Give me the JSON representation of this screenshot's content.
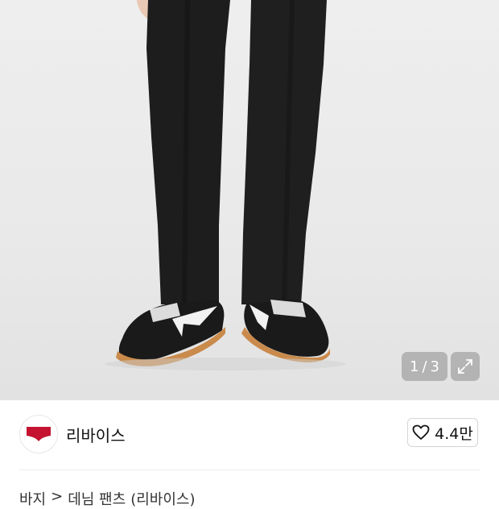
{
  "gallery": {
    "current": "1",
    "separator": "/",
    "total": "3",
    "expand_icon": "expand-icon"
  },
  "brand": {
    "logo_text": "Levi's",
    "name": "리바이스",
    "like_count": "4.4만",
    "heart_icon": "heart-icon"
  },
  "breadcrumb": {
    "items": [
      "바지",
      ">",
      "데님 팬츠",
      "(리바이스)"
    ]
  },
  "colors": {
    "logo_red": "#c41230",
    "text": "#111111"
  }
}
